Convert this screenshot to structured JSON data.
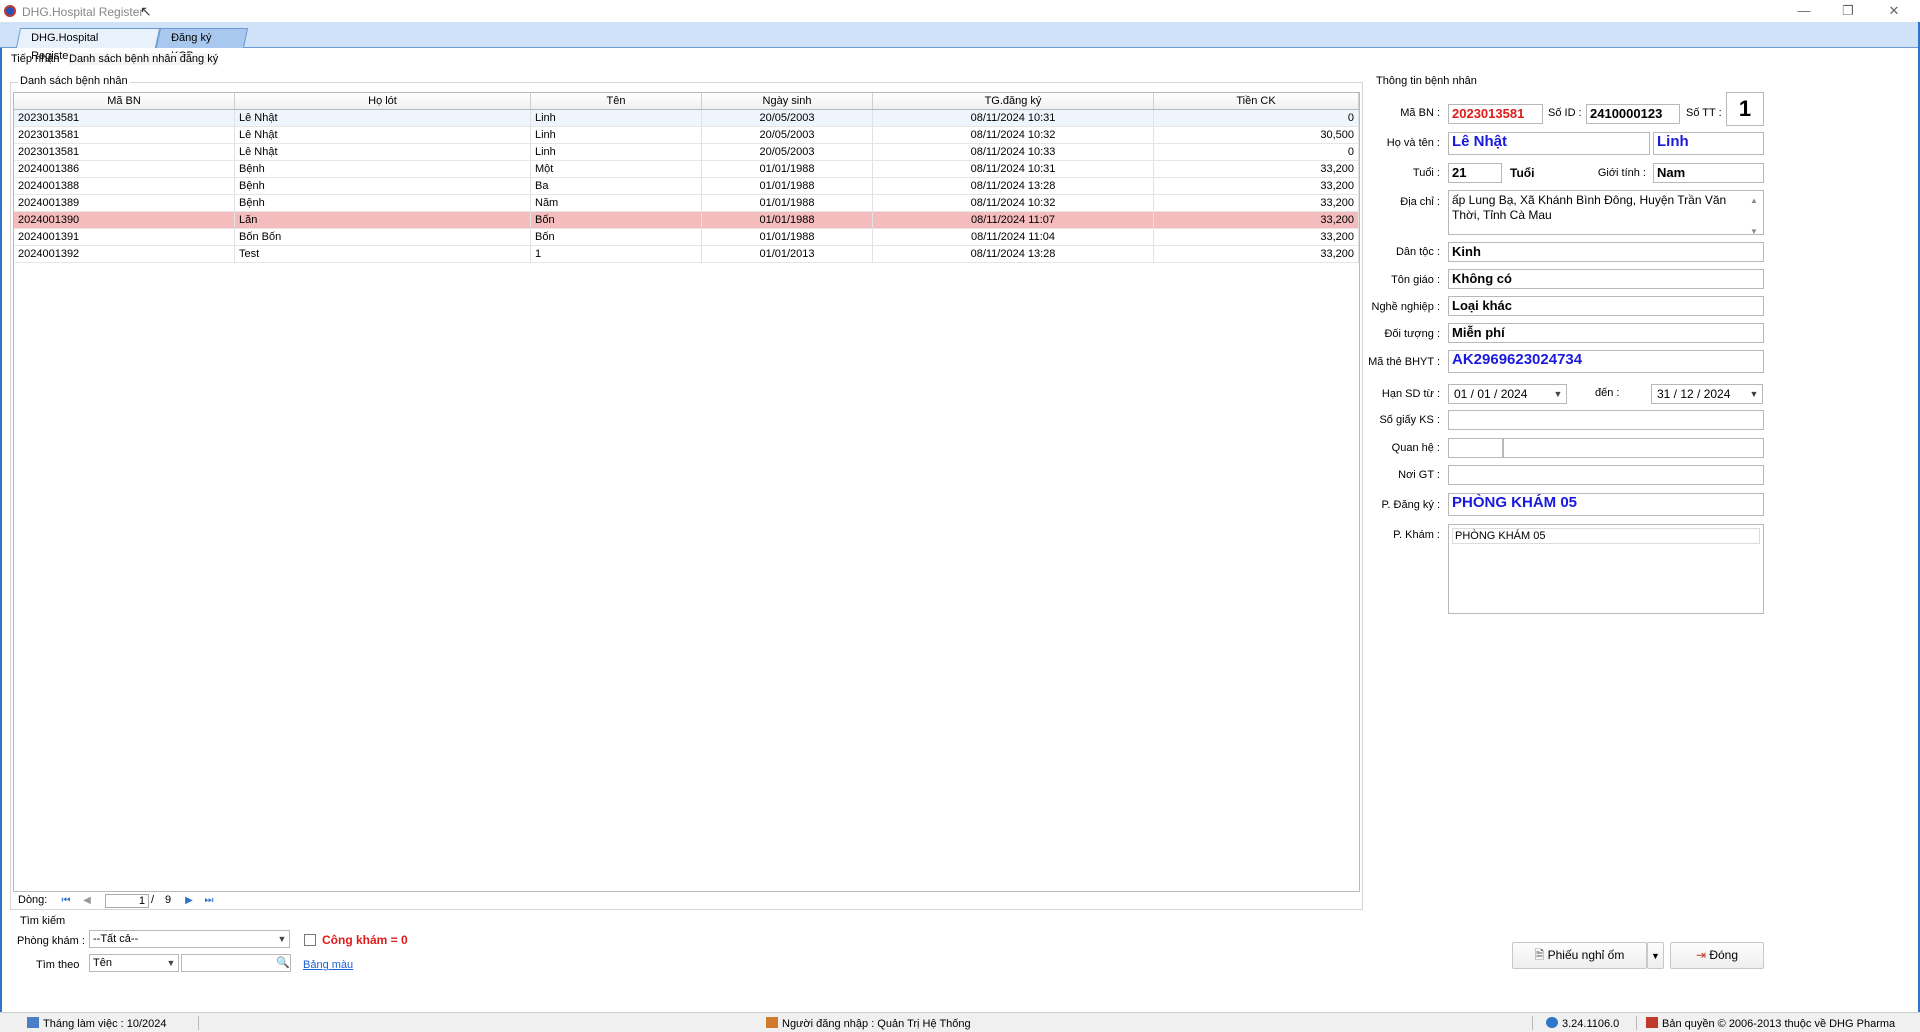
{
  "window": {
    "title": "DHG.Hospital Register",
    "minimize": "—",
    "maximize": "❐",
    "close": "✕"
  },
  "tabs": [
    "DHG.Hospital Register",
    "Đăng ký KCB"
  ],
  "subtabs": [
    "Tiếp nhận",
    "Danh sách bệnh nhân đăng ký"
  ],
  "patient_list": {
    "group_label": "Danh sách bệnh nhân",
    "columns": [
      "Mã BN",
      "Họ lót",
      "Tên",
      "Ngày sinh",
      "TG.đăng ký",
      "Tiền CK"
    ],
    "rows": [
      [
        "2023013581",
        "Lê Nhật",
        "Linh",
        "20/05/2003",
        "08/11/2024 10:31",
        "0"
      ],
      [
        "2023013581",
        "Lê Nhật",
        "Linh",
        "20/05/2003",
        "08/11/2024 10:32",
        "30,500"
      ],
      [
        "2023013581",
        "Lê Nhật",
        "Linh",
        "20/05/2003",
        "08/11/2024 10:33",
        "0"
      ],
      [
        "2024001386",
        "Bệnh",
        "Một",
        "01/01/1988",
        "08/11/2024 10:31",
        "33,200"
      ],
      [
        "2024001388",
        "Bệnh",
        "Ba",
        "01/01/1988",
        "08/11/2024 13:28",
        "33,200"
      ],
      [
        "2024001389",
        "Bệnh",
        "Năm",
        "01/01/1988",
        "08/11/2024 10:32",
        "33,200"
      ],
      [
        "2024001390",
        "Lăn",
        "Bốn",
        "01/01/1988",
        "08/11/2024 11:07",
        "33,200"
      ],
      [
        "2024001391",
        "Bốn Bốn",
        "Bốn",
        "01/01/1988",
        "08/11/2024 11:04",
        "33,200"
      ],
      [
        "2024001392",
        "Test",
        "1",
        "01/01/2013",
        "08/11/2024 13:28",
        "33,200"
      ]
    ],
    "selected_row": 6
  },
  "pager": {
    "label": "Dòng:",
    "current": "1",
    "separator": "/",
    "total": "9"
  },
  "search": {
    "group_label": "Tìm kiếm",
    "phong_kham_label": "Phòng khám :",
    "phong_kham_value": "--Tất cả--",
    "cong_kham_label": "Công khám = 0",
    "tim_theo_label": "Tìm theo",
    "tim_theo_value": "Tên",
    "keyword": "",
    "bang_mau": "Bảng màu"
  },
  "patient_info": {
    "group_label": "Thông tin bệnh nhân",
    "ma_bn_label": "Mã BN :",
    "ma_bn": "2023013581",
    "so_id_label": "Số ID :",
    "so_id": "2410000123",
    "so_tt_label": "Số TT :",
    "so_tt": "1",
    "ho_ten_label": "Họ và tên :",
    "ho_lot": "Lê Nhật",
    "ten": "Linh",
    "tuoi_label": "Tuổi :",
    "tuoi": "21",
    "tuoi_unit": "Tuổi",
    "gioi_tinh_label": "Giới tính :",
    "gioi_tinh": "Nam",
    "dia_chi_label": "Địa chỉ :",
    "dia_chi": "ấp Lung Bạ, Xã Khánh Bình Đông, Huyện Trần Văn Thời, Tỉnh Cà Mau",
    "dan_toc_label": "Dân tộc :",
    "dan_toc": "Kinh",
    "ton_giao_label": "Tôn giáo :",
    "ton_giao": "Không có",
    "nghe_nghiep_label": "Nghề nghiệp :",
    "nghe_nghiep": "Loại khác",
    "doi_tuong_label": "Đối tượng :",
    "doi_tuong": "Miễn phí",
    "ma_the_label": "Mã thẻ BHYT :",
    "ma_the": "AK2969623024734",
    "han_sd_label": "Hạn SD từ :",
    "han_sd_tu": "01 / 01 / 2024",
    "den_label": "đến :",
    "han_sd_den": "31 / 12 / 2024",
    "so_giay_ks_label": "Số giấy KS :",
    "so_giay_ks": "",
    "quan_he_label": "Quan hệ :",
    "quan_he_1": "",
    "quan_he_2": "",
    "noi_gt_label": "Nơi GT :",
    "noi_gt": "",
    "p_dang_ky_label": "P. Đăng ký :",
    "p_dang_ky": "PHÒNG KHÁM 05",
    "p_kham_label": "P. Khám :",
    "p_kham": "PHÒNG KHÁM 05"
  },
  "buttons": {
    "phieu_nghi_om": "Phiếu nghỉ ốm",
    "dong": "Đóng"
  },
  "status": {
    "thang_lam_viec": "Tháng làm việc : 10/2024",
    "nguoi_dang_nhap": "Người đăng nhập : Quản Trị Hệ Thống",
    "version": "3.24.1106.0",
    "copyright": "Bản quyền © 2006-2013 thuộc về DHG Pharma"
  },
  "colors": {
    "selected_row": "#f4bcbc",
    "tab_bar": "#cfe2f7",
    "accent_red": "#e01a1a",
    "accent_blue": "#1a1adc"
  }
}
